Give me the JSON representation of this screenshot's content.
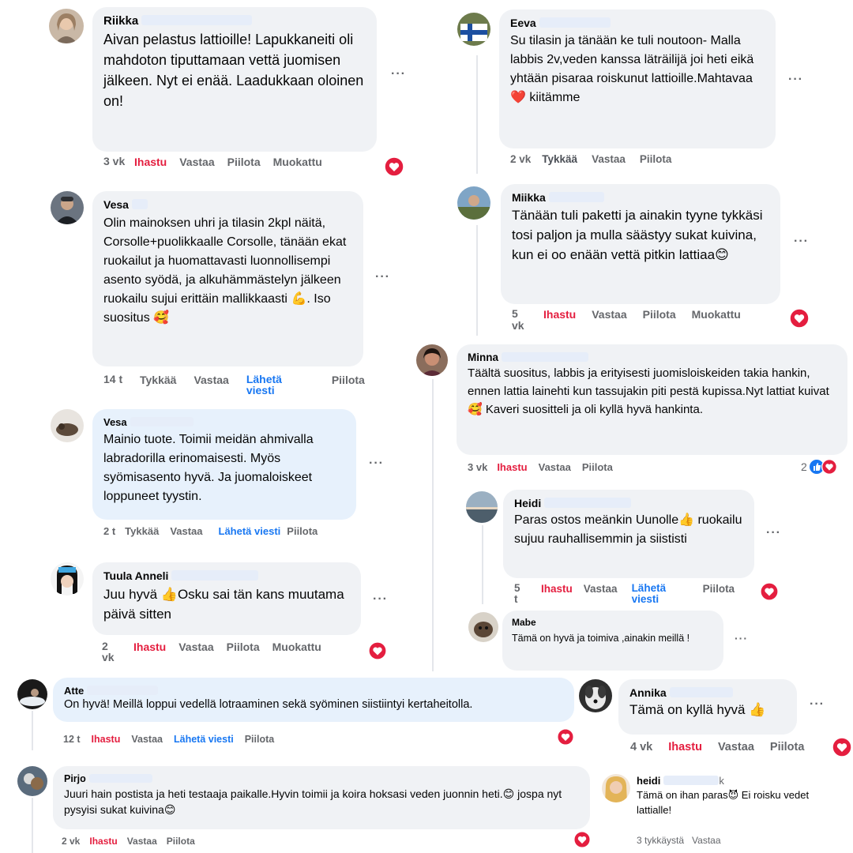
{
  "comments": {
    "riikka": {
      "name": "Riikka",
      "text": "Aivan pelastus lattioille! Lapukkaneiti oli mahdoton tiputtamaan vettä juomisen jälkeen. Nyt ei enää. Laadukkaan oloinen on!",
      "time": "3 vk",
      "like": "Ihastu",
      "reply": "Vastaa",
      "hide": "Piilota",
      "edited": "Muokattu"
    },
    "vesa1": {
      "name": "Vesa",
      "text": "Olin mainoksen uhri ja tilasin 2kpl näitä, Corsolle+puolikkaalle Corsolle, tänään ekat ruokailut ja huomattavasti luonnollisempi asento syödä, ja alkuhämmästelyn jälkeen ruokailu sujui erittäin mallikkaasti",
      "emoji1": "💪",
      "text2": ". Iso suositus",
      "emoji2": "🥰",
      "time": "14 t",
      "like": "Tykkää",
      "reply": "Vastaa",
      "message": "Lähetä viesti",
      "hide": "Piilota"
    },
    "vesa2": {
      "name": "Vesa",
      "text": "Mainio tuote. Toimii meidän ahmivalla labradorilla erinomaisesti. Myös syömisasento hyvä. Ja juomaloiskeet loppuneet tyystin.",
      "time": "2 t",
      "like": "Tykkää",
      "reply": "Vastaa",
      "message": "Lähetä viesti",
      "hide": "Piilota"
    },
    "tuula": {
      "name": "Tuula Anneli",
      "text_a": "Juu hyvä ",
      "emoji": "👍",
      "text_b": "Osku sai tän kans muutama päivä sitten",
      "time": "2 vk",
      "like": "Ihastu",
      "reply": "Vastaa",
      "hide": "Piilota",
      "edited": "Muokattu"
    },
    "eeva": {
      "name": "Eeva",
      "text": "Su tilasin ja tänään ke tuli noutoon- Malla labbis 2v,veden kanssa läträilijä joi heti eikä yhtään pisaraa roiskunut lattioille.Mahtavaa",
      "emoji": "❤️",
      "text2": " kiitämme",
      "time": "2 vk",
      "like": "Tykkää",
      "reply": "Vastaa",
      "hide": "Piilota"
    },
    "miikka": {
      "name": "Miikka",
      "text": "Tänään tuli paketti ja ainakin tyyne tykkäsi tosi paljon ja mulla säästyy sukat kuivina, kun ei oo enään vettä pitkin lattiaa",
      "emoji": "😊",
      "time": "5 vk",
      "like": "Ihastu",
      "reply": "Vastaa",
      "hide": "Piilota",
      "edited": "Muokattu"
    },
    "minna": {
      "name": "Minna",
      "text": "Täältä suositus, labbis ja erityisesti juomisloiskeiden takia hankin, ennen lattia lainehti kun tassujakin piti pestä kupissa.Nyt lattiat kuivat",
      "emoji": "🥰",
      "text2": " Kaveri suositteli ja oli kyllä hyvä hankinta.",
      "time": "3 vk",
      "like": "Ihastu",
      "reply": "Vastaa",
      "hide": "Piilota",
      "reaction_count": "2"
    },
    "heidi": {
      "name": "Heidi",
      "text_a": "Paras ostos meänkin Uunolle",
      "emoji": "👍",
      "text_b": " ruokailu sujuu rauhallisemmin ja siististi",
      "time": "5 t",
      "like": "Ihastu",
      "reply": "Vastaa",
      "message": "Lähetä viesti",
      "hide": "Piilota"
    },
    "mabe": {
      "name": "Mabe",
      "text": "Tämä on hyvä ja toimiva ,ainakin meillä !"
    },
    "atte": {
      "name": "Atte",
      "text": "On hyvä! Meillä loppui vedellä lotraaminen sekä syöminen siistiintyi kertaheitolla.",
      "time": "12 t",
      "like": "Ihastu",
      "reply": "Vastaa",
      "message": "Lähetä viesti",
      "hide": "Piilota"
    },
    "annika": {
      "name": "Annika",
      "text": "Tämä on kyllä hyvä",
      "emoji": "👍",
      "time": "4 vk",
      "like": "Ihastu",
      "reply": "Vastaa",
      "hide": "Piilota"
    },
    "pirjo": {
      "name": "Pirjo",
      "text": "Juuri hain postista ja heti testaaja paikalle.Hyvin toimii ja koira hoksasi veden juonnin heti.",
      "emoji": "😊",
      "text2": " jospa nyt pysyisi sukat kuivina",
      "emoji2": "😊",
      "time": "2 vk",
      "like": "Ihastu",
      "reply": "Vastaa",
      "hide": "Piilota"
    },
    "heidi2": {
      "name": "heidi",
      "name_suffix": "k",
      "text": "Tämä on ihan paras",
      "emoji": "😈",
      "text2": " Ei roisku vedet lattialle!",
      "time": "3 tykkäystä",
      "reply": "Vastaa"
    }
  },
  "more_label": "···",
  "colors": {
    "love": "#e41e3f",
    "link": "#1877f2",
    "bubble": "#f0f2f5",
    "bubble_active": "#e7f1fc",
    "like_blue": "#1877f2"
  },
  "icons": {
    "love_reaction": "heart-reaction-icon",
    "like_reaction": "thumbs-up-reaction-icon",
    "more": "more-dots-icon"
  }
}
